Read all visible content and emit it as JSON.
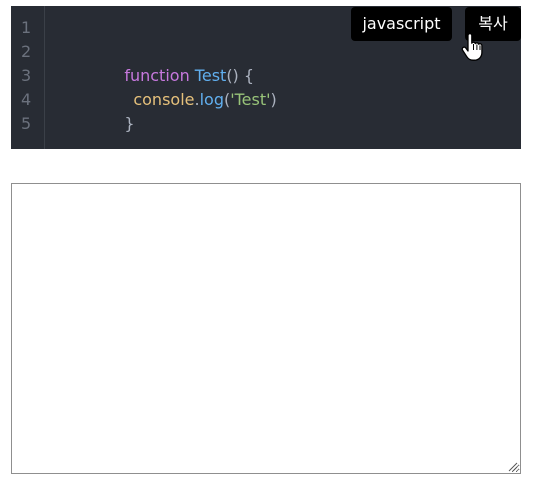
{
  "code_block": {
    "language": "javascript",
    "copy_label": "복사",
    "line_numbers": [
      "1",
      "2",
      "3",
      "4",
      "5"
    ],
    "lines": [
      {
        "tokens": []
      },
      {
        "tokens": [
          {
            "text": "function",
            "kind": "keyword"
          },
          {
            "text": " ",
            "kind": "punc"
          },
          {
            "text": "Test",
            "kind": "func"
          },
          {
            "text": "() {",
            "kind": "punc"
          }
        ]
      },
      {
        "tokens": [
          {
            "text": "console",
            "kind": "obj"
          },
          {
            "text": ".",
            "kind": "punc"
          },
          {
            "text": "log",
            "kind": "func"
          },
          {
            "text": "(",
            "kind": "punc"
          },
          {
            "text": "'Test'",
            "kind": "str"
          },
          {
            "text": ")",
            "kind": "punc"
          }
        ]
      },
      {
        "tokens": [
          {
            "text": "}",
            "kind": "punc"
          }
        ]
      },
      {
        "tokens": []
      }
    ],
    "colors": {
      "background": "#282c34",
      "keyword": "#c678dd",
      "function": "#61afef",
      "object": "#e5c07b",
      "string": "#98c379",
      "punctuation": "#abb2bf"
    }
  },
  "editor": {
    "value": "",
    "placeholder": ""
  }
}
